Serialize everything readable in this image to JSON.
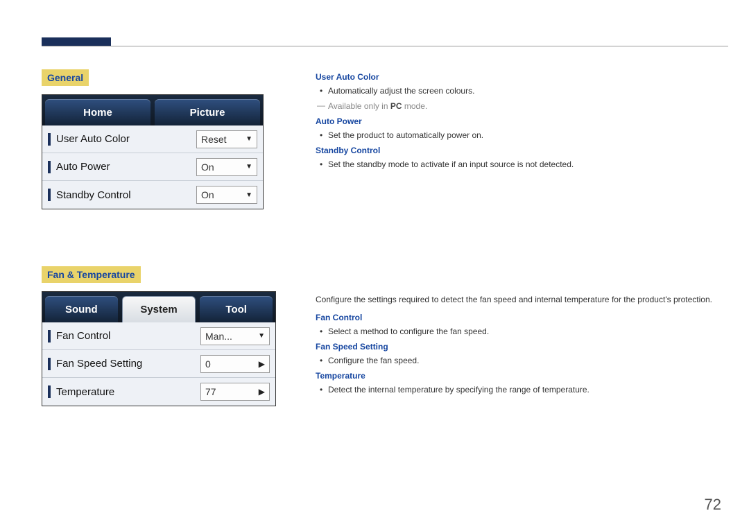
{
  "page_number": "72",
  "sections": {
    "general": {
      "title": "General",
      "mock": {
        "tabs": [
          "Home",
          "Picture"
        ],
        "active_tab_index": 0,
        "rows": [
          {
            "label": "User Auto Color",
            "value": "Reset",
            "control": "dropdown"
          },
          {
            "label": "Auto Power",
            "value": "On",
            "control": "dropdown"
          },
          {
            "label": "Standby Control",
            "value": "On",
            "control": "dropdown"
          }
        ]
      },
      "desc": {
        "user_auto_color": {
          "heading": "User Auto Color",
          "bullets": [
            "Automatically adjust the screen colours."
          ],
          "note_prefix": "Available only in ",
          "note_bold": "PC",
          "note_suffix": " mode."
        },
        "auto_power": {
          "heading": "Auto Power",
          "bullets": [
            "Set the product to automatically power on."
          ]
        },
        "standby_control": {
          "heading": "Standby Control",
          "bullets": [
            "Set the standby mode to activate if an input source is not detected."
          ]
        }
      }
    },
    "fan_temp": {
      "title": "Fan & Temperature",
      "mock": {
        "tabs": [
          "Sound",
          "System",
          "Tool"
        ],
        "active_tab_index": 1,
        "rows": [
          {
            "label": "Fan Control",
            "value": "Man...",
            "control": "dropdown"
          },
          {
            "label": "Fan Speed Setting",
            "value": "0",
            "control": "spinner"
          },
          {
            "label": "Temperature",
            "value": "77",
            "control": "spinner"
          }
        ]
      },
      "desc": {
        "intro": "Configure the settings required to detect the fan speed and internal temperature for the product's protection.",
        "fan_control": {
          "heading": "Fan Control",
          "bullets": [
            "Select a method to configure the fan speed."
          ]
        },
        "fan_speed_setting": {
          "heading": "Fan Speed Setting",
          "bullets": [
            "Configure the fan speed."
          ]
        },
        "temperature": {
          "heading": "Temperature",
          "bullets": [
            "Detect the internal temperature by specifying the range of temperature."
          ]
        }
      }
    }
  }
}
